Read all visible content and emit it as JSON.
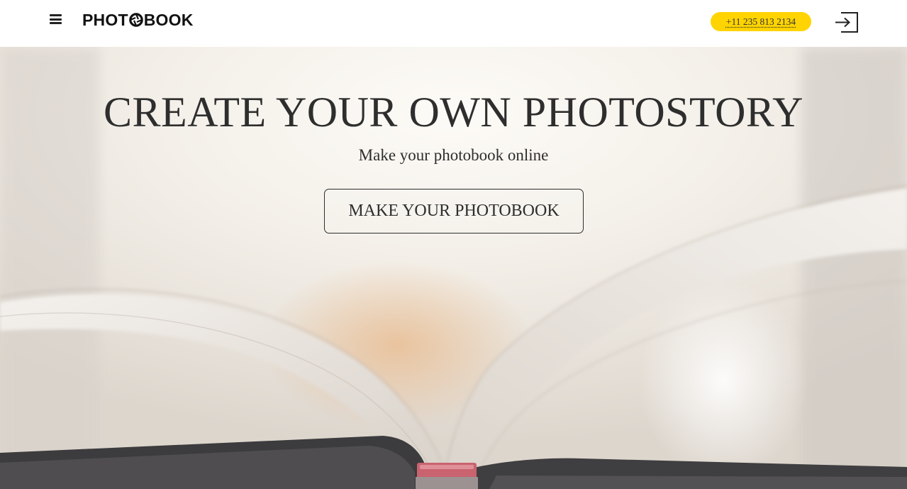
{
  "header": {
    "logo_text_before": "PHOT",
    "logo_text_after": "BOOK",
    "phone": "+11 235 813 2134",
    "phone_pill_color": "#ffd400"
  },
  "hero": {
    "title": "CREATE YOUR OWN PHOTOSTORY",
    "subtitle": "Make your photobook online",
    "cta_label": "MAKE YOUR PHOTOBOOK"
  },
  "icons": {
    "menu": "hamburger-icon",
    "logo_mark": "aperture-icon",
    "login": "sign-in-icon"
  },
  "colors": {
    "accent": "#ffd400",
    "text": "#2e2e2e"
  }
}
